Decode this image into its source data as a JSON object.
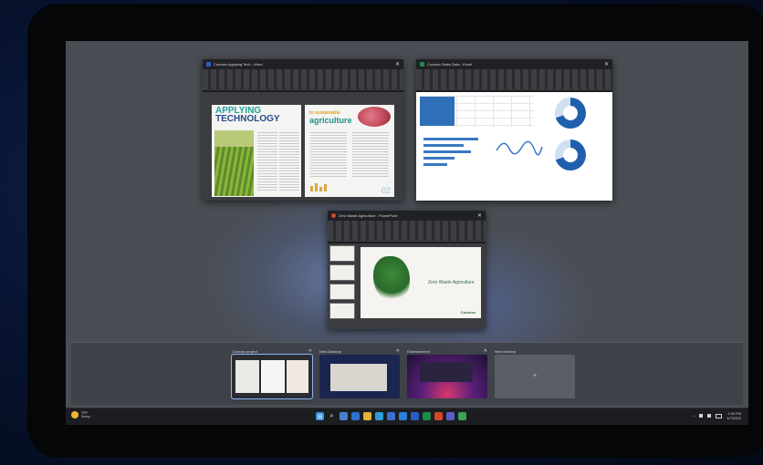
{
  "windows": {
    "word": {
      "title": "Contoso Applying Tech - Word",
      "headline_line1": "APPLYING",
      "headline_line2": "TECHNOLOGY",
      "kicker": "to sustainable",
      "headline_right": "agriculture",
      "page_number": "02",
      "close_glyph": "✕"
    },
    "excel": {
      "title": "Contoso Sales Data - Excel",
      "close_glyph": "✕"
    },
    "powerpoint": {
      "title": "Zero Waste Agriculture - PowerPoint",
      "slide_title": "Zero Waste Agriculture",
      "brand": "Contoso",
      "close_glyph": "✕"
    }
  },
  "desktops": [
    {
      "label": "Contoso project",
      "active": true
    },
    {
      "label": "New Desktop",
      "active": false
    },
    {
      "label": "Entertainment",
      "active": false
    },
    {
      "label": "New desktop",
      "active": false,
      "add": "+"
    }
  ],
  "taskbar": {
    "weather_temp": "75°F",
    "weather_desc": "Sunny",
    "icons": [
      {
        "name": "start-icon",
        "color": "#3a8ee6",
        "glyph": "⊞"
      },
      {
        "name": "search-icon",
        "color": "#1c1d21",
        "glyph": "⌕"
      },
      {
        "name": "task-view-icon",
        "color": "#4a7fd0",
        "glyph": ""
      },
      {
        "name": "widgets-icon",
        "color": "#2f6fcf",
        "glyph": ""
      },
      {
        "name": "file-explorer-icon",
        "color": "#e5b23a",
        "glyph": ""
      },
      {
        "name": "edge-icon",
        "color": "#2d9bd6",
        "glyph": ""
      },
      {
        "name": "store-icon",
        "color": "#3a6fd3",
        "glyph": ""
      },
      {
        "name": "mail-icon",
        "color": "#2a7fd6",
        "glyph": ""
      },
      {
        "name": "word-icon",
        "color": "#2b5cc4",
        "glyph": ""
      },
      {
        "name": "excel-icon",
        "color": "#1e8a4a",
        "glyph": ""
      },
      {
        "name": "powerpoint-icon",
        "color": "#d04a2a",
        "glyph": ""
      },
      {
        "name": "teams-icon",
        "color": "#5a5fc8",
        "glyph": ""
      },
      {
        "name": "app-icon",
        "color": "#3aa35a",
        "glyph": ""
      }
    ],
    "tray_chevron": "^",
    "time": "1:30 PM",
    "date": "4/7/2022"
  }
}
